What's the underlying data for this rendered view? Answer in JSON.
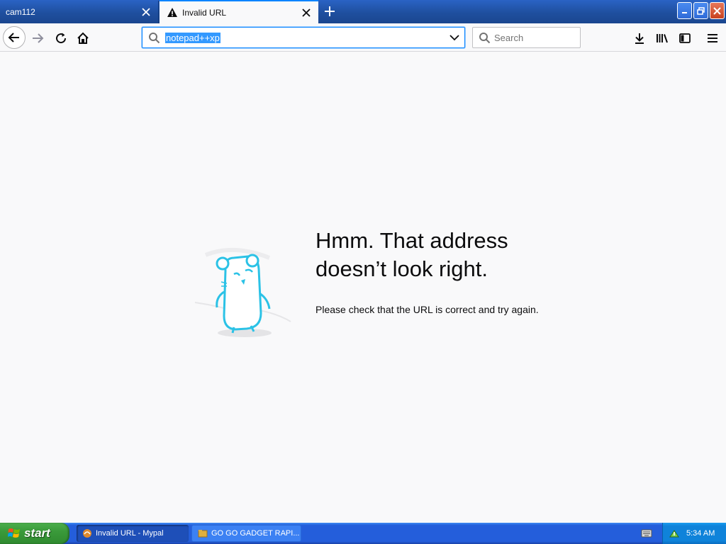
{
  "tabs": [
    {
      "label": "cam112",
      "active": false
    },
    {
      "label": "Invalid URL",
      "active": true
    }
  ],
  "navbar": {
    "url_value": "notepad++xp",
    "search_placeholder": "Search"
  },
  "error": {
    "title_line1": "Hmm. That address",
    "title_line2": "doesn’t look right.",
    "description": "Please check that the URL is correct and try again."
  },
  "taskbar": {
    "start_label": "start",
    "tasks": [
      {
        "label": "Invalid URL - Mypal",
        "active": true
      },
      {
        "label": "GO GO GADGET RAPI...",
        "active": false
      }
    ],
    "clock": "5:34 AM"
  },
  "colors": {
    "accent": "#0a84ff",
    "tab_strip": "#1f4f9f",
    "selection": "#3399ff",
    "taskbar": "#245edb",
    "start_green": "#3a9a3a"
  }
}
